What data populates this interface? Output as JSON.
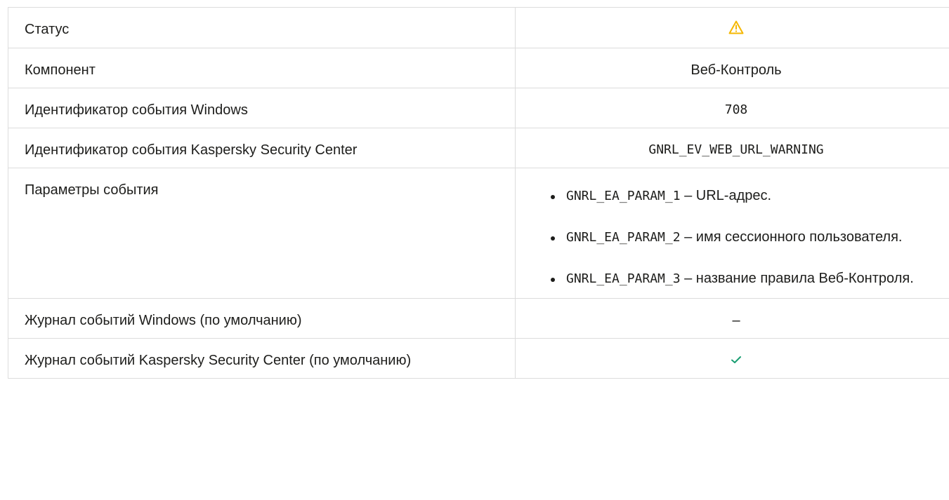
{
  "rows": {
    "status": {
      "label": "Статус",
      "icon": "warning-triangle-icon",
      "icon_color": "#f5b700"
    },
    "component": {
      "label": "Компонент",
      "value": "Веб-Контроль"
    },
    "windows_event_id": {
      "label": "Идентификатор события Windows",
      "value": "708"
    },
    "ksc_event_id": {
      "label": "Идентификатор события Kaspersky Security Center",
      "value": "GNRL_EV_WEB_URL_WARNING"
    },
    "event_params": {
      "label": "Параметры события",
      "items": [
        {
          "code": "GNRL_EA_PARAM_1",
          "text": " – URL-адрес."
        },
        {
          "code": "GNRL_EA_PARAM_2",
          "text": " – имя сессионного пользователя."
        },
        {
          "code": "GNRL_EA_PARAM_3",
          "text": " – название правила Веб-Контроля."
        }
      ]
    },
    "windows_log": {
      "label": "Журнал событий Windows (по умолчанию)",
      "value": "–"
    },
    "ksc_log": {
      "label": "Журнал событий Kaspersky Security Center (по умолчанию)",
      "icon": "checkmark-icon",
      "icon_color": "#1a9e72"
    }
  }
}
